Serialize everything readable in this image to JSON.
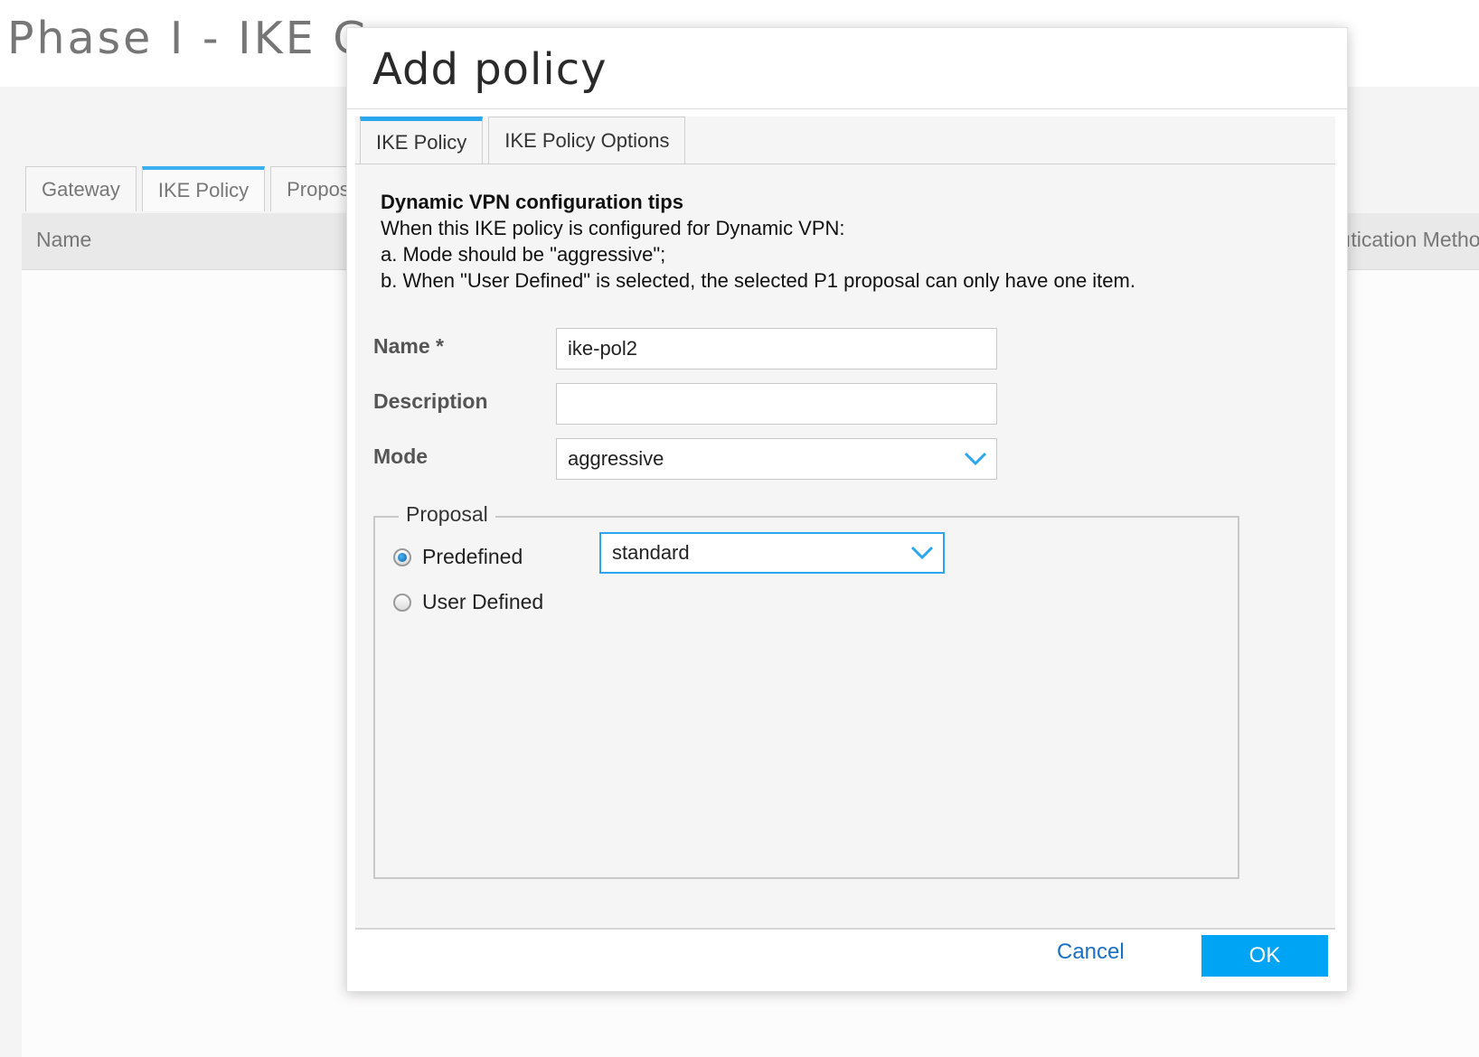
{
  "background": {
    "page_title": "Phase I - IKE Ga",
    "tabs": [
      {
        "label": "Gateway"
      },
      {
        "label": "IKE Policy"
      },
      {
        "label": "Propos"
      }
    ],
    "table": {
      "col_name": "Name",
      "col_auth": "ıtication Metho"
    }
  },
  "modal": {
    "title": "Add policy",
    "tabs": [
      {
        "label": "IKE Policy"
      },
      {
        "label": "IKE Policy Options"
      }
    ],
    "tips": {
      "title": "Dynamic VPN configuration tips",
      "line1": "When this IKE policy is configured for Dynamic VPN:",
      "line2": "a. Mode should be \"aggressive\";",
      "line3": "b. When \"User Defined\" is selected, the selected P1 proposal can only have one item."
    },
    "form": {
      "name_label": "Name *",
      "name_value": "ike-pol2",
      "description_label": "Description",
      "description_value": "",
      "mode_label": "Mode",
      "mode_value": "aggressive"
    },
    "proposal": {
      "legend": "Proposal",
      "predefined_label": "Predefined",
      "predefined_value": "standard",
      "user_defined_label": "User Defined"
    },
    "footer": {
      "cancel_label": "Cancel",
      "ok_label": "OK"
    }
  },
  "colors": {
    "accent": "#2aa8ee",
    "ok_button": "#00a4f4",
    "link": "#1b6fc2"
  },
  "icons": [
    "chevron-down-icon",
    "radio-checked-icon",
    "radio-unchecked-icon"
  ]
}
